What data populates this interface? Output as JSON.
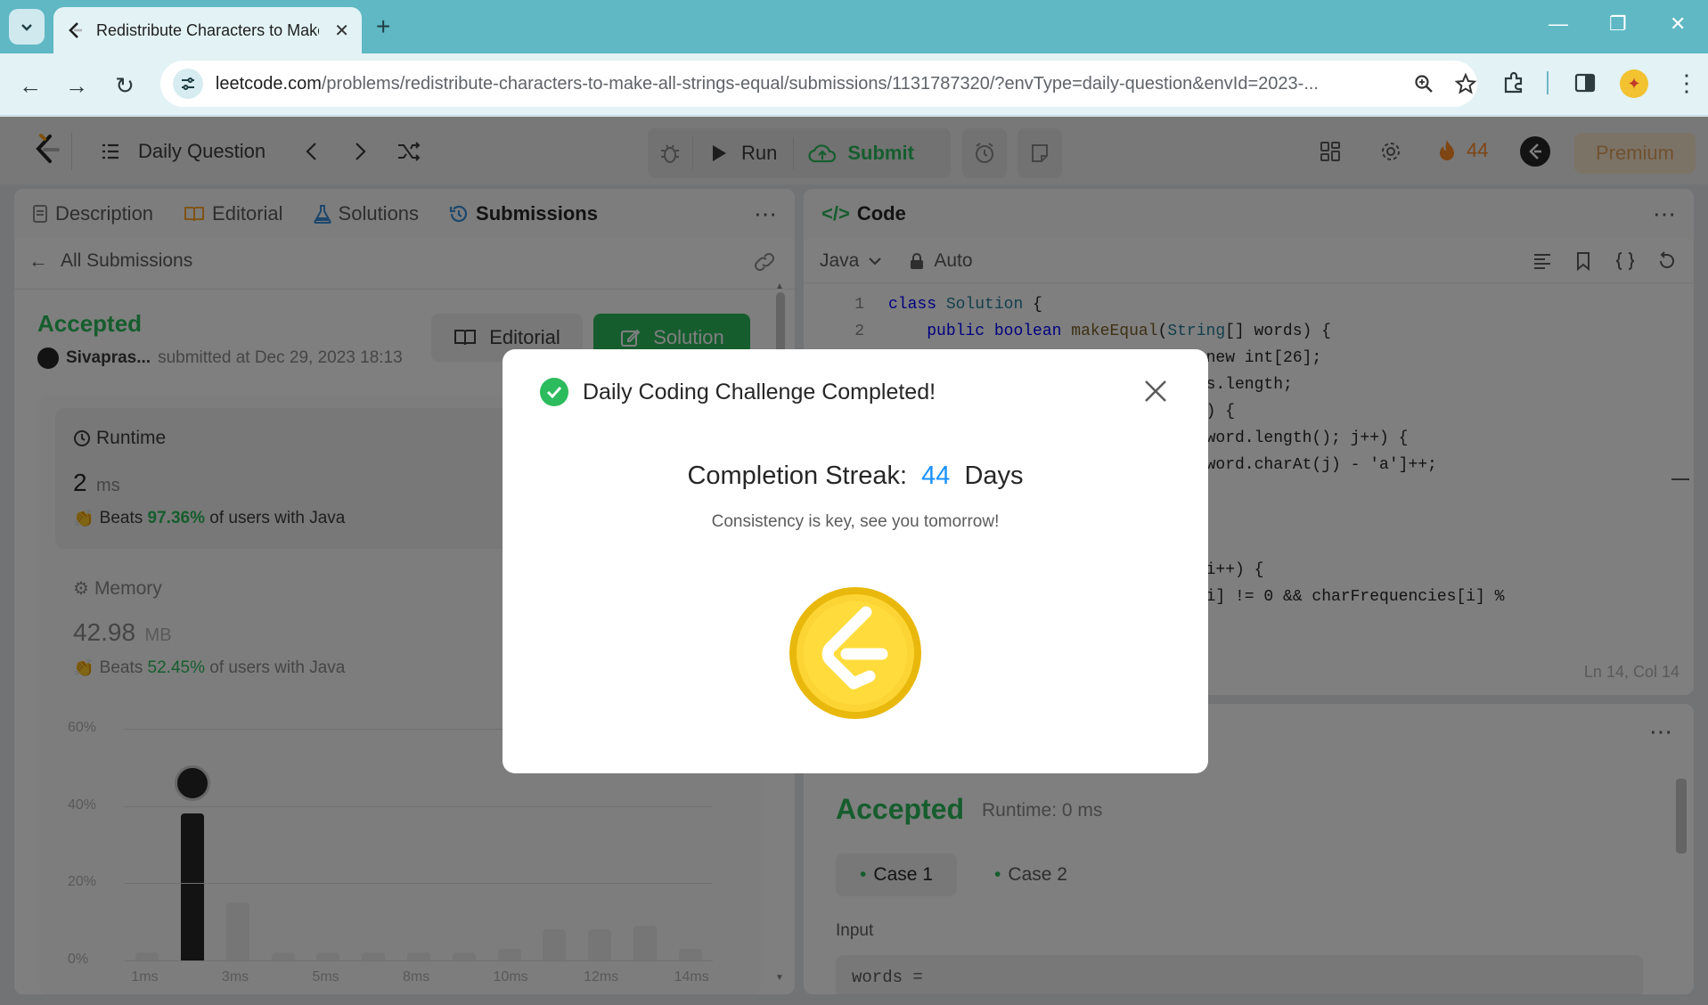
{
  "browser": {
    "tab_title": "Redistribute Characters to Make All Strings Equal",
    "url_host": "leetcode.com",
    "url_path": "/problems/redistribute-characters-to-make-all-strings-equal/submissions/1131787320/?envType=daily-question&envId=2023-..."
  },
  "header": {
    "list_title": "Daily Question",
    "run_label": "Run",
    "submit_label": "Submit",
    "streak_count": "44",
    "premium_label": "Premium"
  },
  "left_panel": {
    "tabs": [
      {
        "label": "Description"
      },
      {
        "label": "Editorial"
      },
      {
        "label": "Solutions"
      },
      {
        "label": "Submissions"
      }
    ],
    "back_label": "All Submissions",
    "status": "Accepted",
    "user": "Sivapras...",
    "submitted_at": "submitted at Dec 29, 2023 18:13",
    "editorial_btn": "Editorial",
    "solution_btn": "Solution",
    "runtime": {
      "title": "Runtime",
      "value": "2",
      "unit": "ms",
      "beats_prefix": "Beats",
      "beats_pct": "97.36%",
      "beats_suffix": "of users with Java"
    },
    "memory": {
      "title": "Memory",
      "value": "42.98",
      "unit": "MB",
      "beats_prefix": "Beats",
      "beats_pct": "52.45%",
      "beats_suffix": "of users with Java"
    }
  },
  "chart_data": {
    "type": "bar",
    "ytick_labels": [
      "60%",
      "40%",
      "20%",
      "0%"
    ],
    "xtick_labels": [
      "1ms",
      "3ms",
      "5ms",
      "8ms",
      "10ms",
      "12ms",
      "14ms"
    ],
    "ylim": [
      0,
      60
    ],
    "values": [
      2,
      38,
      15,
      2,
      2,
      2,
      2,
      2,
      3,
      8,
      8,
      9,
      3
    ],
    "highlight_index": 1
  },
  "code_panel": {
    "title": "Code",
    "language": "Java",
    "mode": "Auto",
    "cursor": "Ln 14, Col 14",
    "lines": [
      {
        "n": "1",
        "text": "class Solution {"
      },
      {
        "n": "2",
        "text": "    public boolean makeEqual(String[] words) {"
      }
    ],
    "visible_fragments": [
      "= new int[26];",
      "rds.length;",
      "ds) {",
      "< word.length(); j++) {",
      "s[word.charAt(j) - 'a']++;",
      "; i++) {",
      "s[i] != 0 && charFrequencies[i] %"
    ]
  },
  "result_panel": {
    "status": "Accepted",
    "runtime": "Runtime: 0 ms",
    "cases": [
      "Case 1",
      "Case 2"
    ],
    "input_label": "Input",
    "input_value": "words ="
  },
  "modal": {
    "title": "Daily Coding Challenge Completed!",
    "streak_label": "Completion Streak:",
    "streak_value": "44",
    "streak_unit": "Days",
    "message": "Consistency is key, see you tomorrow!"
  }
}
